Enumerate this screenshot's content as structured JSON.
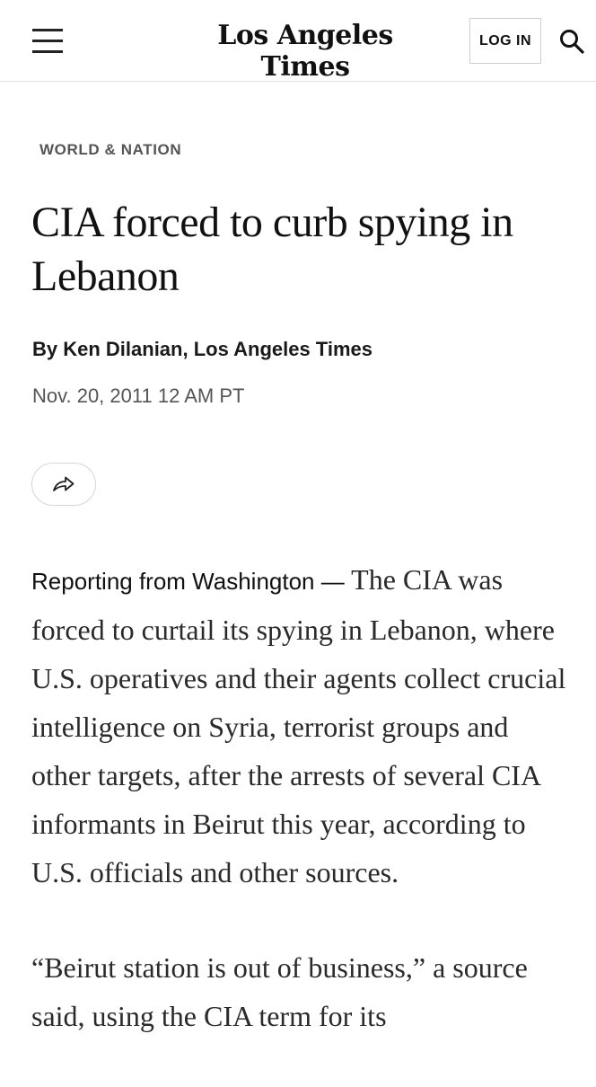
{
  "header": {
    "menu_icon": "hamburger-menu-icon",
    "logo_text": "Los Angeles Times",
    "login_label": "LOG IN",
    "search_icon": "search-icon"
  },
  "article": {
    "section": "WORLD & NATION",
    "headline": "CIA forced to curb spying in Lebanon",
    "byline": "By Ken Dilanian, Los Angeles Times",
    "date": "Nov. 20, 2011 12 AM PT",
    "share_icon": "share-arrow-icon",
    "paragraph1_lede": "Reporting from Washington —",
    "paragraph1_body": "The CIA was forced to curtail its spying in Lebanon, where U.S. operatives and their agents collect crucial intelligence on Syria, terrorist groups and other targets, after the arrests of several CIA informants in Beirut this year, according to U.S. officials and other sources.",
    "paragraph2_body": "“Beirut station is out of business,” a source said, using the CIA term for its"
  },
  "colors": {
    "text": "#111111",
    "muted": "#555555",
    "divider": "#e2e2e2"
  }
}
